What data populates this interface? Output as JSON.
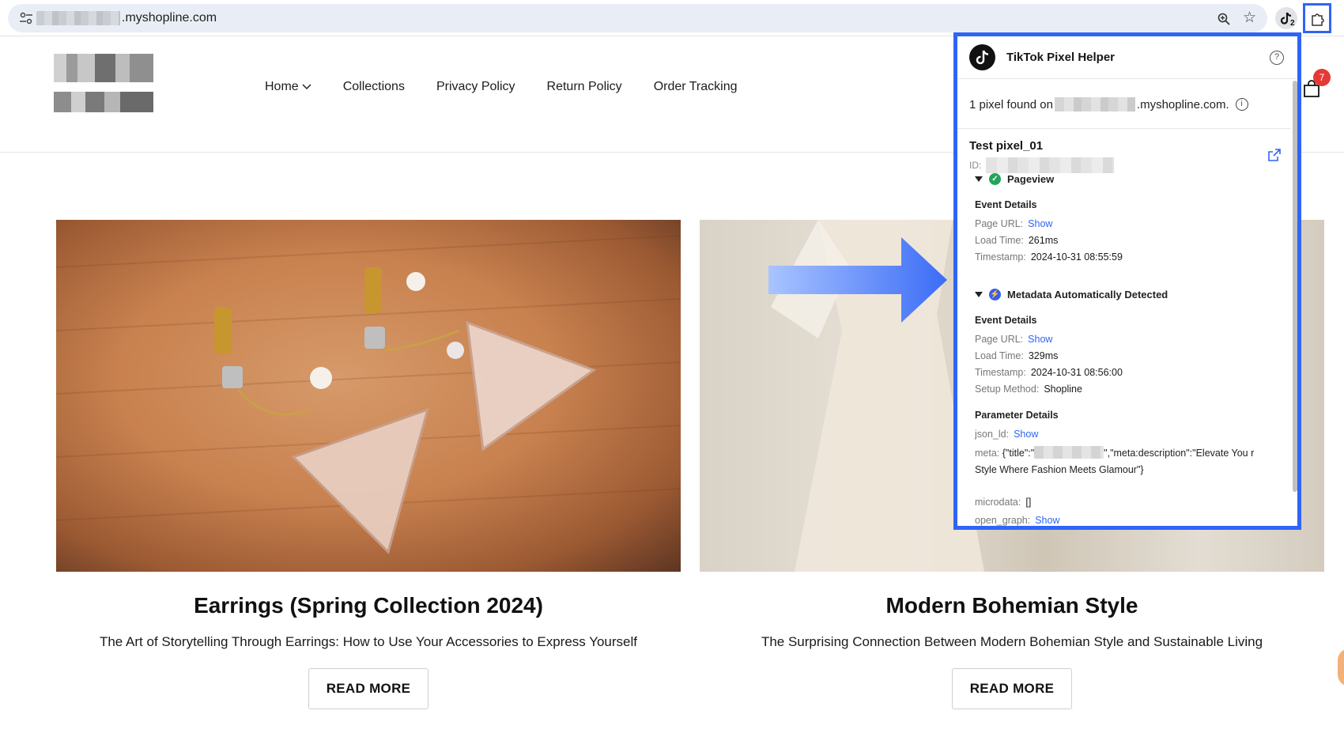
{
  "browser": {
    "url_suffix": ".myshopline.com",
    "tiktok_ext_badge": "2"
  },
  "store": {
    "nav": [
      {
        "label": "Home"
      },
      {
        "label": "Collections"
      },
      {
        "label": "Privacy Policy"
      },
      {
        "label": "Return Policy"
      },
      {
        "label": "Order Tracking"
      }
    ],
    "cart_count": "7"
  },
  "cards": [
    {
      "title": "Earrings (Spring Collection 2024)",
      "subtitle": "The Art of Storytelling Through Earrings: How to Use Your Accessories to Express Yourself",
      "button": "READ MORE"
    },
    {
      "title": "Modern Bohemian Style",
      "subtitle": "The Surprising Connection Between Modern Bohemian Style and Sustainable Living",
      "button": "READ MORE"
    }
  ],
  "popup": {
    "title": "TikTok Pixel Helper",
    "found_prefix": "1 pixel found on",
    "found_suffix": ".myshopline.com.",
    "pixel_name": "Test pixel_01",
    "id_label": "ID:",
    "pageview": {
      "name": "Pageview",
      "details_title": "Event Details",
      "page_url_label": "Page URL:",
      "page_url_link": "Show",
      "load_time_label": "Load Time:",
      "load_time": "261ms",
      "timestamp_label": "Timestamp:",
      "timestamp": "2024-10-31 08:55:59"
    },
    "metadata": {
      "name": "Metadata Automatically Detected",
      "details_title": "Event Details",
      "page_url_label": "Page URL:",
      "page_url_link": "Show",
      "load_time_label": "Load Time:",
      "load_time": "329ms",
      "timestamp_label": "Timestamp:",
      "timestamp": "2024-10-31 08:56:00",
      "setup_label": "Setup Method:",
      "setup": "Shopline",
      "param_title": "Parameter Details",
      "json_ld_label": "json_ld:",
      "json_ld_link": "Show",
      "meta_label": "meta:",
      "meta_prefix": "{\"title\":\"",
      "meta_suffix": "\",\"meta:description\":\"Elevate You r Style Where Fashion Meets Glamour\"}",
      "microdata_label": "microdata:",
      "microdata": "[]",
      "open_graph_label": "open_graph:",
      "open_graph_link": "Show"
    }
  }
}
